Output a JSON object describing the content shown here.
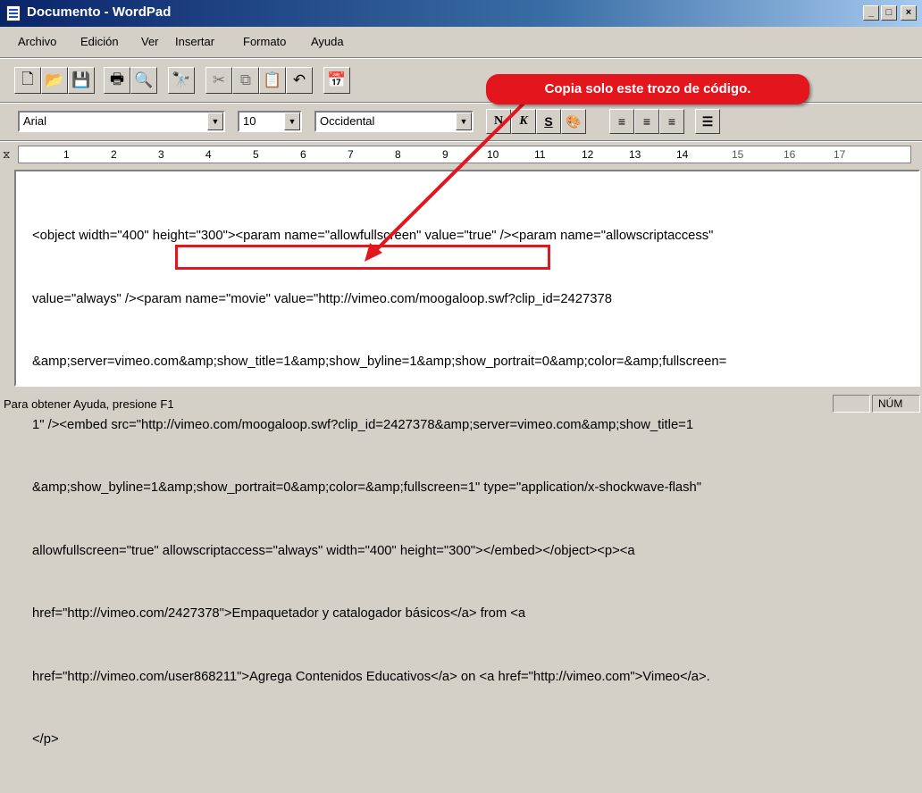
{
  "window": {
    "title": "Documento - WordPad",
    "min_label": "_",
    "max_label": "□",
    "close_label": "×"
  },
  "menu": [
    "Archivo",
    "Edición",
    "Ver",
    "Insertar",
    "Formato",
    "Ayuda"
  ],
  "toolbar_icons": [
    "new-icon",
    "open-icon",
    "save-icon",
    "print-icon",
    "print-preview-icon",
    "find-icon",
    "cut-icon",
    "copy-icon",
    "paste-icon",
    "undo-icon",
    "insert-date-icon"
  ],
  "format": {
    "font": "Arial",
    "size": "10",
    "script": "Occidental",
    "bold": "N",
    "italic": "K",
    "underline": "S"
  },
  "ruler_numbers": [
    "1",
    "2",
    "3",
    "4",
    "5",
    "6",
    "7",
    "8",
    "9",
    "10",
    "11",
    "12",
    "13",
    "14",
    "15",
    "16",
    "17"
  ],
  "callout": "Copia solo este trozo de código.",
  "document_lines": [
    "<object width=\"400\" height=\"300\"><param name=\"allowfullscreen\" value=\"true\" /><param name=\"allowscriptaccess\"",
    "value=\"always\" /><param name=\"movie\" value=\"http://vimeo.com/moogaloop.swf?clip_id=2427378",
    "&amp;server=vimeo.com&amp;show_title=1&amp;show_byline=1&amp;show_portrait=0&amp;color=&amp;fullscreen=",
    "1\" /><embed src=\"http://vimeo.com/moogaloop.swf?clip_id=2427378&amp;server=vimeo.com&amp;show_title=1",
    "&amp;show_byline=1&amp;show_portrait=0&amp;color=&amp;fullscreen=1\" type=\"application/x-shockwave-flash\"",
    "allowfullscreen=\"true\" allowscriptaccess=\"always\" width=\"400\" height=\"300\"></embed></object><p><a",
    "href=\"http://vimeo.com/2427378\">Empaquetador y catalogador básicos</a> from <a",
    "href=\"http://vimeo.com/user868211\">Agrega Contenidos Educativos</a> on <a href=\"http://vimeo.com\">Vimeo</a>.",
    "</p>"
  ],
  "status": {
    "help": "Para obtener Ayuda, presione F1",
    "num": "NÚM"
  },
  "colors": {
    "accent": "#e3161d",
    "title_bar": "#0a246a"
  }
}
